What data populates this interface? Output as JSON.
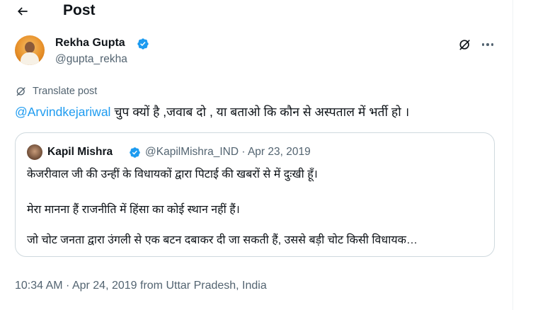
{
  "header": {
    "title": "Post",
    "back_icon": "arrow-left-icon"
  },
  "post": {
    "author": {
      "name": "Rekha Gupta",
      "handle": "@gupta_rekha",
      "verified": true
    },
    "translate_label": "Translate post",
    "mention": "@Arvindkejariwal",
    "text": " चुप क्यों है ,जवाब दो , या बताओ कि कौन से अस्पताल में भर्ती हो ।",
    "timestamp": "10:34 AM · Apr 24, 2019 from Uttar Pradesh, India"
  },
  "quote": {
    "author": {
      "name": "Kapil Mishra",
      "verified": true
    },
    "meta": "@KapilMishra_IND · Apr 23, 2019",
    "lines": [
      "केजरीवाल जी की उन्हीं के विधायकों द्वारा पिटाई की खबरों से में दुःखी हूँ।",
      "मेरा मानना हैं राजनीति में हिंसा का कोई स्थान नहीं हैं।",
      "जो चोट जनता द्वारा उंगली से एक बटन दबाकर दी जा सकती हैं, उससे बड़ी चोट किसी विधायक…"
    ]
  },
  "colors": {
    "accent": "#1d9bf0",
    "secondary_text": "#536471",
    "primary_text": "#0f1419",
    "border": "#cfd9de"
  }
}
